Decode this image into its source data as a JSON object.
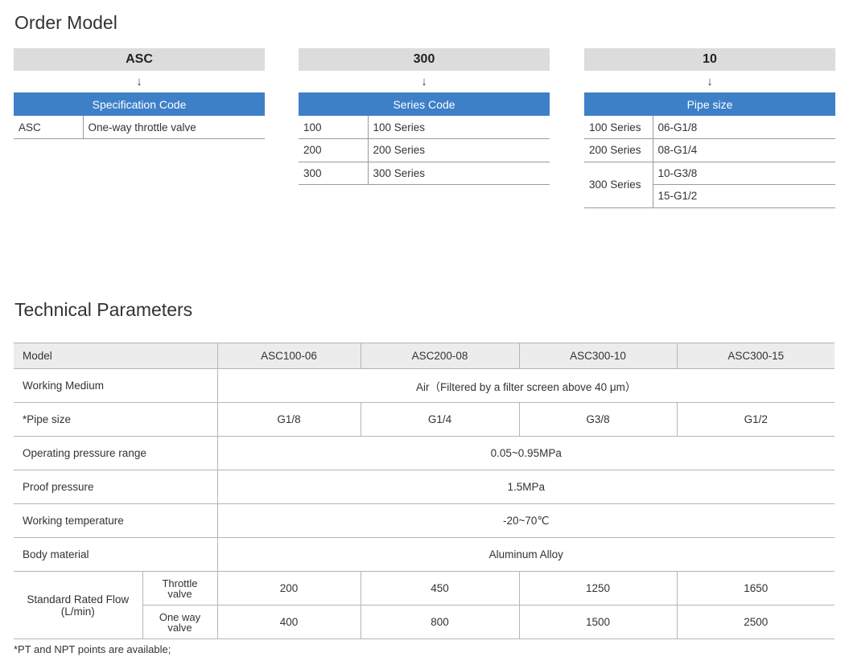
{
  "order_model": {
    "title": "Order Model",
    "arrow": "↓",
    "blocks": [
      {
        "code": "ASC",
        "header": "Specification Code",
        "rows": [
          {
            "k": "ASC",
            "v": "One-way throttle valve"
          }
        ]
      },
      {
        "code": "300",
        "header": "Series Code",
        "rows": [
          {
            "k": "100",
            "v": "100 Series"
          },
          {
            "k": "200",
            "v": "200 Series"
          },
          {
            "k": "300",
            "v": "300 Series"
          }
        ]
      },
      {
        "code": "10",
        "header": "Pipe size",
        "rows": [
          {
            "k": "100 Series",
            "v": "06-G1/8"
          },
          {
            "k": "200 Series",
            "v": "08-G1/4"
          },
          {
            "k": "300 Series",
            "v": "10-G3/8"
          },
          {
            "k": "",
            "v": "15-G1/2"
          }
        ]
      }
    ]
  },
  "technical_parameters": {
    "title": "Technical Parameters",
    "header": {
      "label": "Model",
      "models": [
        "ASC100-06",
        "ASC200-08",
        "ASC300-10",
        "ASC300-15"
      ]
    },
    "working_medium": {
      "label": "Working Medium",
      "value": "Air（Filtered by a filter screen above 40 μm）"
    },
    "pipe_size": {
      "label": "*Pipe size",
      "values": [
        "G1/8",
        "G1/4",
        "G3/8",
        "G1/2"
      ]
    },
    "operating_pressure": {
      "label": "Operating pressure range",
      "value": "0.05~0.95MPa"
    },
    "proof_pressure": {
      "label": "Proof pressure",
      "value": "1.5MPa"
    },
    "working_temperature": {
      "label": "Working temperature",
      "value": "-20~70℃"
    },
    "body_material": {
      "label": "Body material",
      "value": "Aluminum Alloy"
    },
    "flow": {
      "label_line1": "Standard Rated Flow",
      "label_line2": "(L/min)",
      "throttle": {
        "line1": "Throttle",
        "line2": "valve",
        "values": [
          "200",
          "450",
          "1250",
          "1650"
        ]
      },
      "oneway": {
        "line1": "One way",
        "line2": "valve",
        "values": [
          "400",
          "800",
          "1500",
          "2500"
        ]
      }
    }
  },
  "footnote": "*PT and NPT points are available;"
}
